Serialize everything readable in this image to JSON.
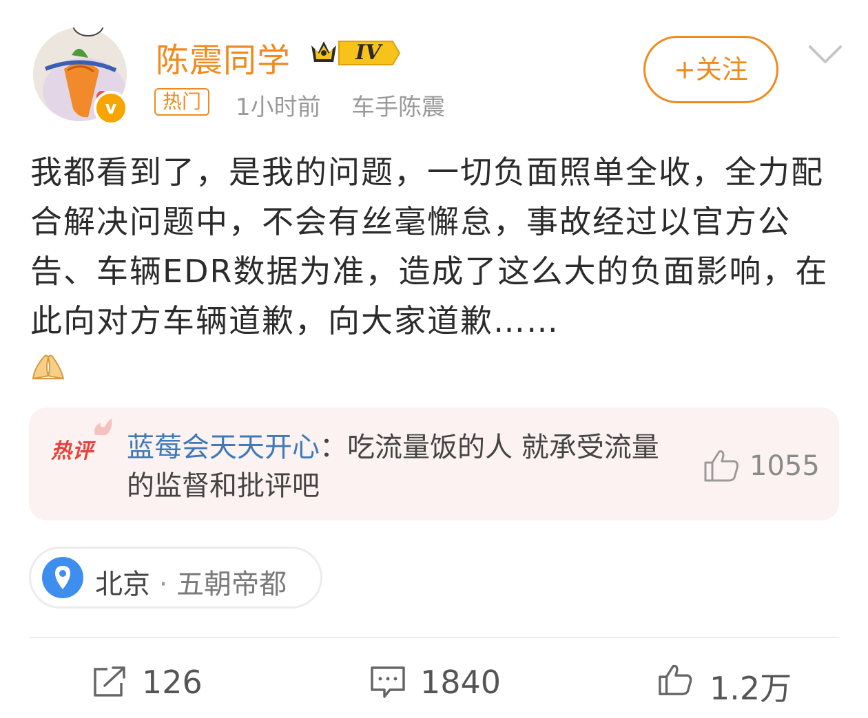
{
  "post": {
    "author": {
      "name": "陈震同学",
      "level": "IV",
      "verified_mark": "v"
    },
    "tag": "热门",
    "time": "1小时前",
    "source": "车手陈震",
    "follow_label": "+关注",
    "text": "我都看到了，是我的问题，一切负面照单全收，全力配合解决问题中，不会有丝毫懈怠，事故经过以官方公告、车辆EDR数据为准，造成了这么大的负面影响，在此向对方车辆道歉，向大家道歉……",
    "emoji": "folded-hands-emoji"
  },
  "hot_comment": {
    "label": "热评",
    "user": "蓝莓会天天开心",
    "colon": "：",
    "text": "吃流量饭的人 就承受流量的监督和批评吧",
    "likes": "1055"
  },
  "location": {
    "city": "北京",
    "separator": " · ",
    "subtitle": "五朝帝都"
  },
  "actions": {
    "repost_count": "126",
    "comment_count": "1840",
    "like_count": "1.2万"
  },
  "colors": {
    "accent": "#f08a1c",
    "hot_red": "#e8403a",
    "link_blue": "#3f79b7",
    "location_blue": "#3e8ef0"
  }
}
